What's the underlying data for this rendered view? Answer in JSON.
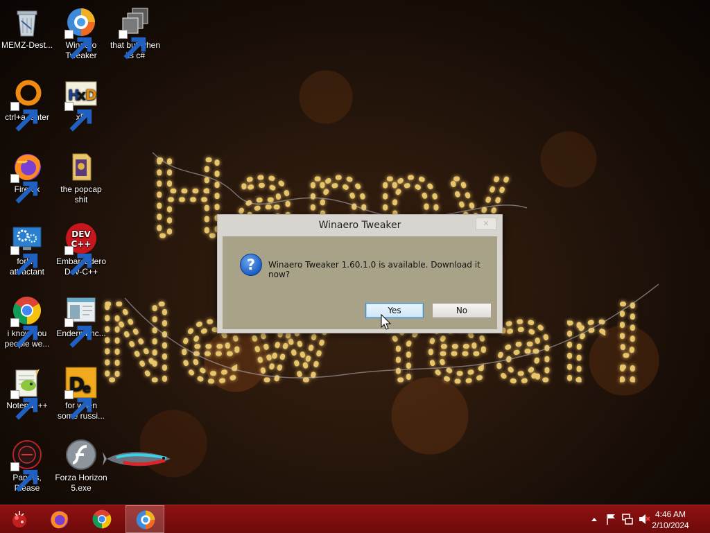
{
  "greeting": {
    "line1": "Happy",
    "line2": "New Year!"
  },
  "desktop_icons": [
    {
      "label": "MEMZ-Dest...",
      "icon": "recycle-bin-icon"
    },
    {
      "label": "Winaero Tweaker",
      "icon": "winaero-tweaker-icon"
    },
    {
      "label": "that but when its c#",
      "icon": "stacked-windows-icon"
    },
    {
      "label": "ctrl+a, enter",
      "icon": "orange-ring-icon"
    },
    {
      "label": "xD",
      "icon": "hxd-hex-editor-icon"
    },
    {
      "label": "Firefox",
      "icon": "firefox-icon"
    },
    {
      "label": "the popcap shit",
      "icon": "folder-icon"
    },
    {
      "label": "forkie attractant",
      "icon": "gear-monitor-icon"
    },
    {
      "label": "Embarcadero Dev-C++",
      "icon": "devcpp-icon"
    },
    {
      "label": "i know you people we...",
      "icon": "chrome-icon"
    },
    {
      "label": "Endermanc...",
      "icon": "window-app-icon"
    },
    {
      "label": "Notepad++",
      "icon": "notepadpp-icon"
    },
    {
      "label": "for when some russi...",
      "icon": "de-app-icon"
    },
    {
      "label": "Papers, Please",
      "icon": "papers-please-icon"
    },
    {
      "label": "Forza Horizon 5.exe",
      "icon": "flash-player-icon"
    }
  ],
  "dialog": {
    "title": "Winaero Tweaker",
    "close_label": "✕",
    "message": "Winaero Tweaker 1.60.1.0 is available. Download it now?",
    "yes_label": "Yes",
    "no_label": "No"
  },
  "taskbar": {
    "apps": [
      "start-button",
      "firefox-icon",
      "chrome-icon",
      "winaero-tweaker-icon"
    ],
    "active_app": "winaero-tweaker-icon",
    "clock_time": "4:46 AM",
    "clock_date": "2/10/2024",
    "tray_icons": [
      "chevron-up-icon",
      "flag-icon",
      "network-icon",
      "volume-muted-icon"
    ]
  }
}
